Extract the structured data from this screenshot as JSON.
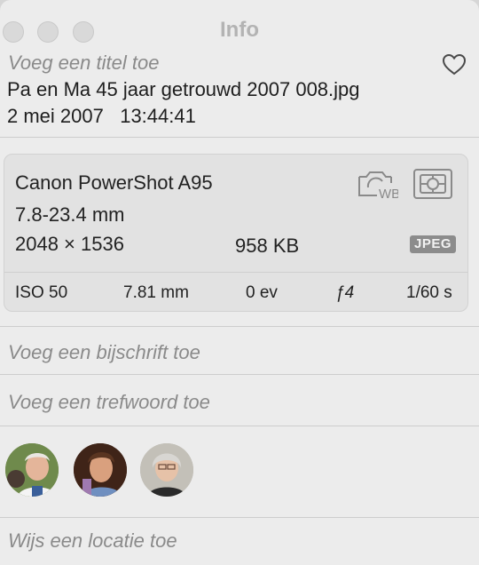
{
  "window": {
    "title": "Info"
  },
  "photo": {
    "title_placeholder": "Voeg een titel toe",
    "filename": "Pa en Ma 45 jaar getrouwd 2007 008.jpg",
    "date": "2 mei 2007",
    "time": "13:44:41",
    "favorite_icon": "heart-outline-icon"
  },
  "camera": {
    "model": "Canon PowerShot A95",
    "lens": "7.8-23.4 mm",
    "dimensions": "2048 × 1536",
    "file_size": "958 KB",
    "format": "JPEG",
    "white_balance_icon": "camera-wb-icon",
    "metering_icon": "metering-mode-icon"
  },
  "exif": {
    "iso": "ISO 50",
    "focal_length": "7.81 mm",
    "exposure_bias": "0 ev",
    "aperture": "ƒ4",
    "shutter": "1/60 s"
  },
  "fields": {
    "caption_placeholder": "Voeg een bijschrift toe",
    "keyword_placeholder": "Voeg een trefwoord toe",
    "location_placeholder": "Wijs een locatie toe"
  },
  "people": [
    {
      "name": "face-1",
      "bg": "#7a8a52"
    },
    {
      "name": "face-2",
      "bg": "#4a2b1c"
    },
    {
      "name": "face-3",
      "bg": "#b9b6ae"
    }
  ]
}
